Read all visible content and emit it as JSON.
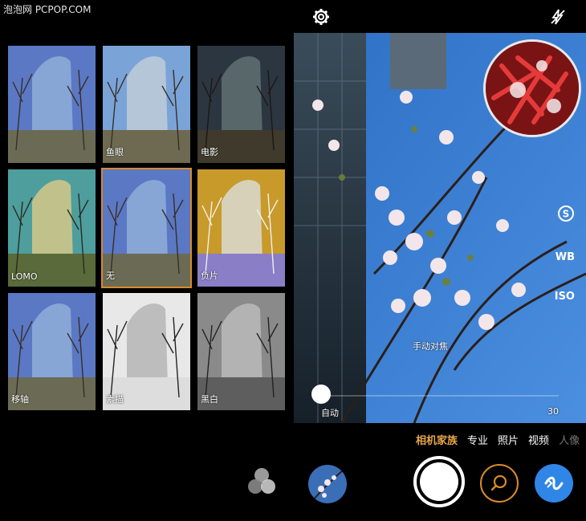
{
  "watermark": "泡泡网 PCPOP.COM",
  "top_bar": {
    "settings_icon": "gear-icon",
    "flash_icon": "flash-off-icon"
  },
  "filters": [
    {
      "label": "",
      "tone": "normal"
    },
    {
      "label": "鱼眼",
      "tone": "warm"
    },
    {
      "label": "电影",
      "tone": "dark"
    },
    {
      "label": "LOMO",
      "tone": "lomo"
    },
    {
      "label": "无",
      "tone": "normal",
      "selected": true
    },
    {
      "label": "负片",
      "tone": "negative"
    },
    {
      "label": "移轴",
      "tone": "normal"
    },
    {
      "label": "素描",
      "tone": "sketch"
    },
    {
      "label": "黑白",
      "tone": "bw"
    }
  ],
  "viewfinder": {
    "side_tools": [
      "S",
      "WB",
      "ISO"
    ],
    "focus_label": "手动对焦",
    "auto_label": "自动",
    "scale_value": "30"
  },
  "modes": {
    "items": [
      "相机家族",
      "专业",
      "照片",
      "视频",
      "人像"
    ],
    "active_index": 0
  },
  "bottom_bar": {
    "filters_icon": "filter-circles-icon",
    "lens_icon": "lens-search-icon",
    "switch_icon": "camera-switch-icon"
  }
}
